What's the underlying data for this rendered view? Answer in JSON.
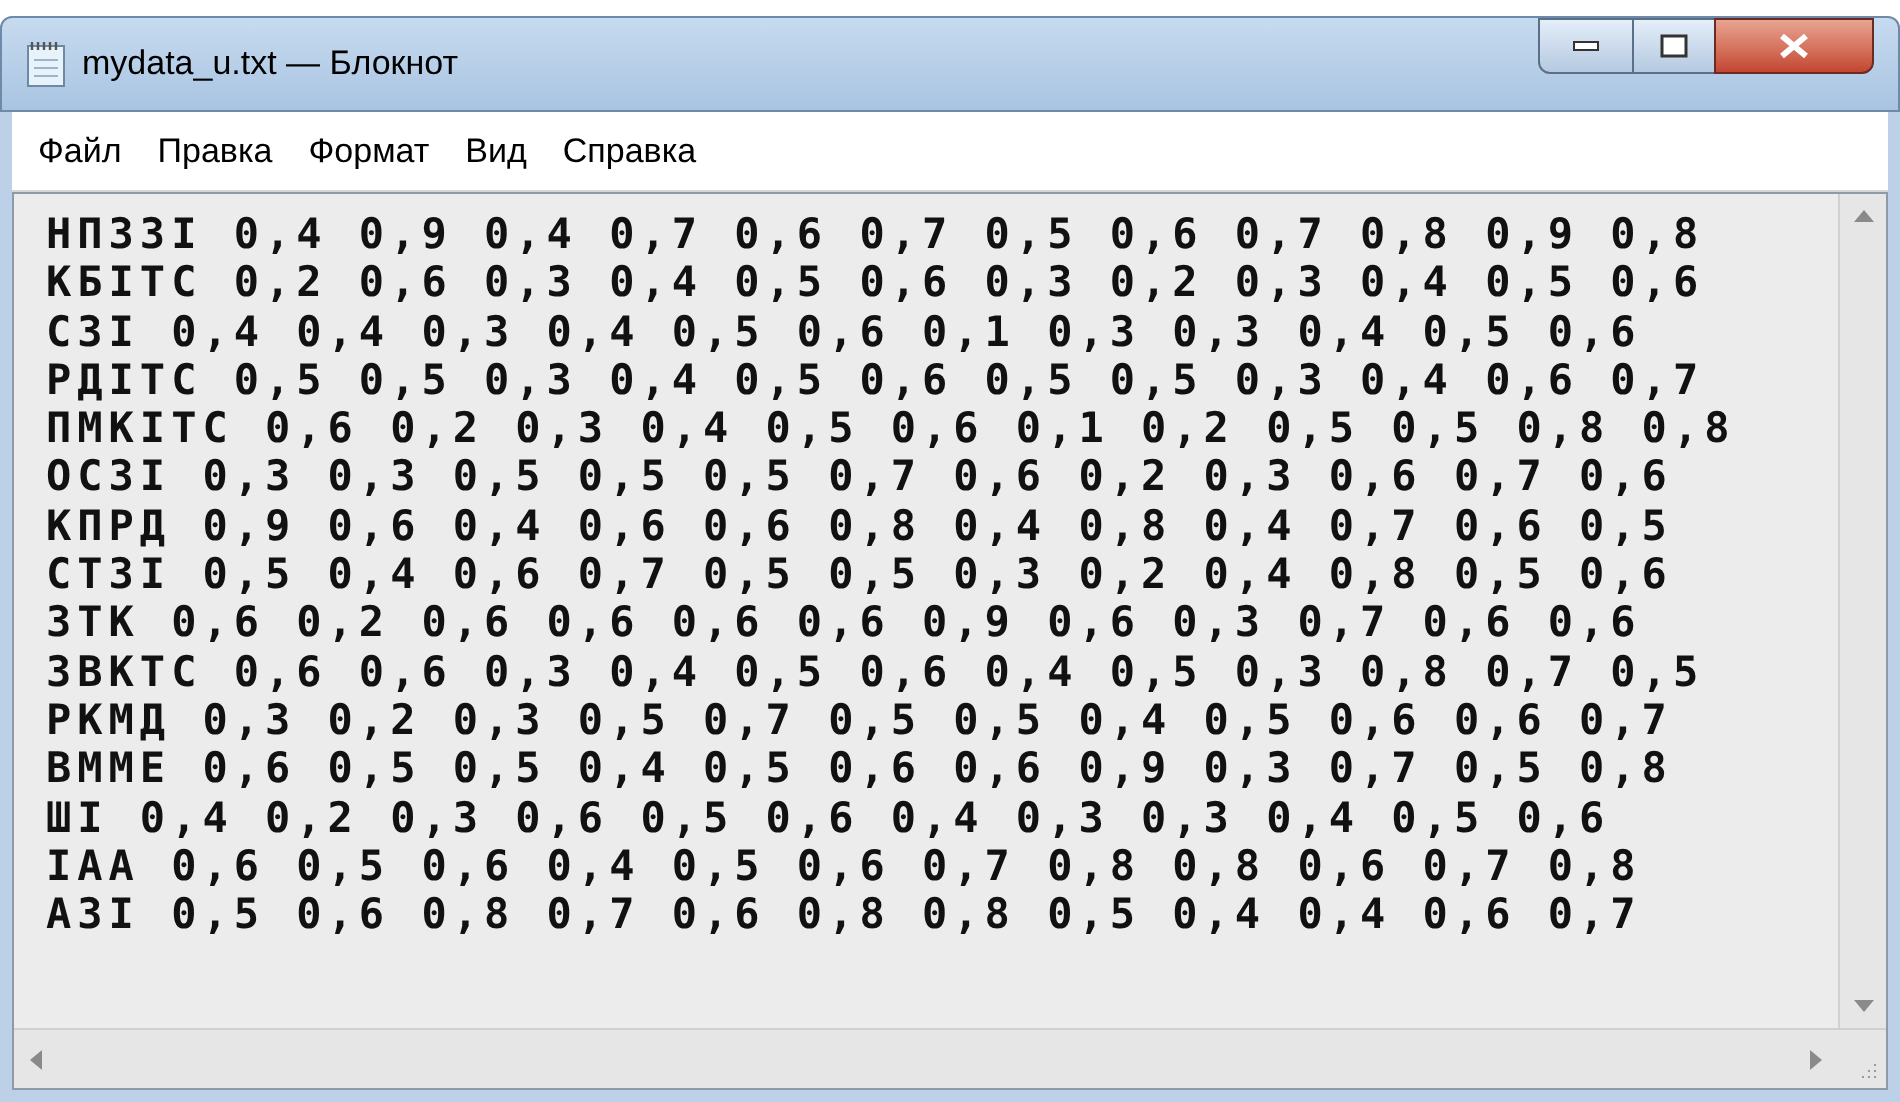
{
  "window": {
    "title": "mydata_u.txt — Блокнот"
  },
  "menu": [
    "Файл",
    "Правка",
    "Формат",
    "Вид",
    "Справка"
  ],
  "lines": [
    "НПЗЗІ 0,4 0,9 0,4 0,7 0,6 0,7 0,5 0,6 0,7 0,8 0,9 0,8",
    "КБІТС 0,2 0,6 0,3 0,4 0,5 0,6 0,3 0,2 0,3 0,4 0,5 0,6",
    "СЗІ 0,4 0,4 0,3 0,4 0,5 0,6 0,1 0,3 0,3 0,4 0,5 0,6",
    "РДІТС 0,5 0,5 0,3 0,4 0,5 0,6 0,5 0,5 0,3 0,4 0,6 0,7",
    "ПМКІТС 0,6 0,2 0,3 0,4 0,5 0,6 0,1 0,2 0,5 0,5 0,8 0,8",
    "ОСЗІ 0,3 0,3 0,5 0,5 0,5 0,7 0,6 0,2 0,3 0,6 0,7 0,6",
    "КПРД 0,9 0,6 0,4 0,6 0,6 0,8 0,4 0,8 0,4 0,7 0,6 0,5",
    "СТЗІ 0,5 0,4 0,6 0,7 0,5 0,5 0,3 0,2 0,4 0,8 0,5 0,6",
    "ЗТК 0,6 0,2 0,6 0,6 0,6 0,6 0,9 0,6 0,3 0,7 0,6 0,6",
    "ЗВКТС 0,6 0,6 0,3 0,4 0,5 0,6 0,4 0,5 0,3 0,8 0,7 0,5",
    "РКМД 0,3 0,2 0,3 0,5 0,7 0,5 0,5 0,4 0,5 0,6 0,6 0,7",
    "ВММЕ 0,6 0,5 0,5 0,4 0,5 0,6 0,6 0,9 0,3 0,7 0,5 0,8",
    "ШІ 0,4 0,2 0,3 0,6 0,5 0,6 0,4 0,3 0,3 0,4 0,5 0,6",
    "ІАА 0,6 0,5 0,6 0,4 0,5 0,6 0,7 0,8 0,8 0,6 0,7 0,8",
    "АЗІ 0,5 0,6 0,8 0,7 0,6 0,8 0,8 0,5 0,4 0,4 0,6 0,7"
  ]
}
